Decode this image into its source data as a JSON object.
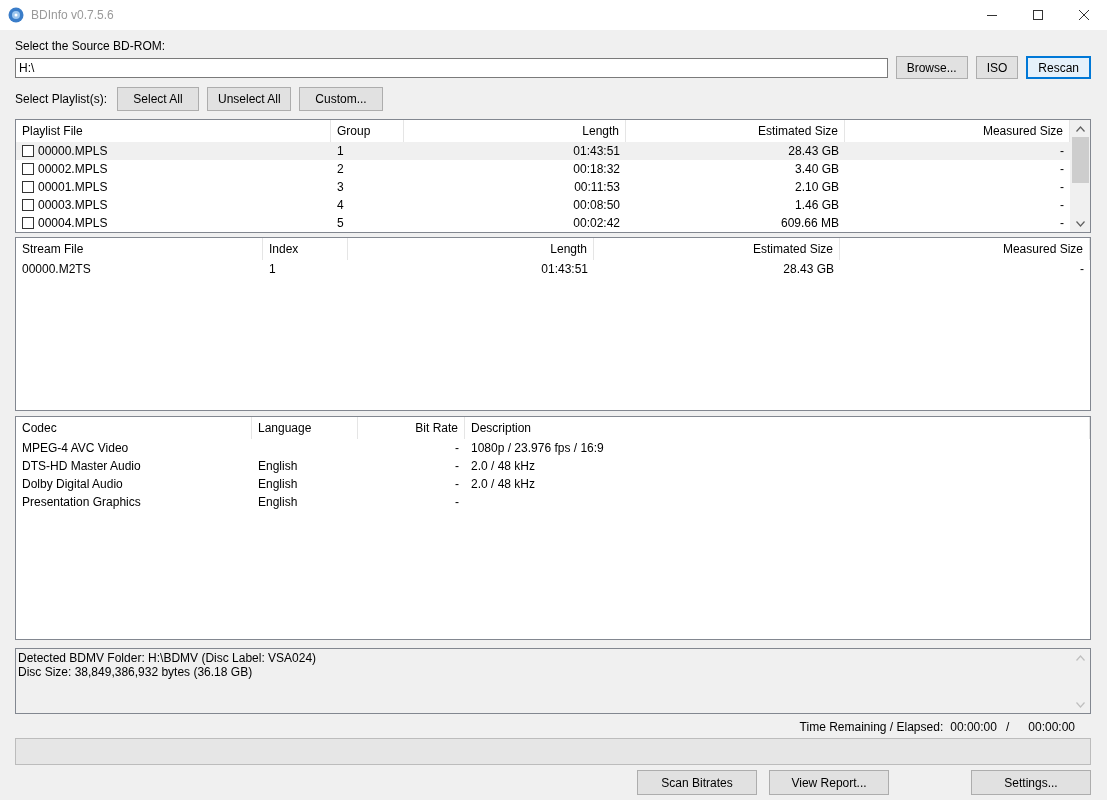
{
  "window": {
    "title": "BDInfo v0.7.5.6"
  },
  "source": {
    "label": "Select the Source BD-ROM:",
    "value": "H:\\",
    "buttons": [
      {
        "label": "Browse...",
        "selected": false
      },
      {
        "label": "ISO",
        "selected": false
      },
      {
        "label": "Rescan",
        "selected": true
      }
    ]
  },
  "playlist_select": {
    "label": "Select Playlist(s):",
    "buttons": [
      "Select All",
      "Unselect All",
      "Custom..."
    ]
  },
  "playlists": {
    "columns": [
      "Playlist File",
      "Group",
      "Length",
      "Estimated Size",
      "Measured Size"
    ],
    "rows": [
      {
        "checked": false,
        "selected": true,
        "cells": [
          "00000.MPLS",
          "1",
          "01:43:51",
          "28.43 GB",
          "-"
        ]
      },
      {
        "checked": false,
        "selected": false,
        "cells": [
          "00002.MPLS",
          "2",
          "00:18:32",
          "3.40 GB",
          "-"
        ]
      },
      {
        "checked": false,
        "selected": false,
        "cells": [
          "00001.MPLS",
          "3",
          "00:11:53",
          "2.10 GB",
          "-"
        ]
      },
      {
        "checked": false,
        "selected": false,
        "cells": [
          "00003.MPLS",
          "4",
          "00:08:50",
          "1.46 GB",
          "-"
        ]
      },
      {
        "checked": false,
        "selected": false,
        "cells": [
          "00004.MPLS",
          "5",
          "00:02:42",
          "609.66 MB",
          "-"
        ]
      }
    ]
  },
  "streams": {
    "columns": [
      "Stream File",
      "Index",
      "Length",
      "Estimated Size",
      "Measured Size"
    ],
    "rows": [
      [
        "00000.M2TS",
        "1",
        "01:43:51",
        "28.43 GB",
        "-"
      ]
    ]
  },
  "codecs": {
    "columns": [
      "Codec",
      "Language",
      "Bit Rate",
      "Description"
    ],
    "rows": [
      [
        "MPEG-4 AVC Video",
        "",
        "-",
        "1080p / 23.976 fps / 16:9"
      ],
      [
        "DTS-HD Master Audio",
        "English",
        "-",
        "2.0 / 48 kHz"
      ],
      [
        "Dolby Digital Audio",
        "English",
        "-",
        "2.0 / 48 kHz"
      ],
      [
        "Presentation Graphics",
        "English",
        "-",
        ""
      ]
    ]
  },
  "log": [
    "Detected BDMV Folder: H:\\BDMV (Disc Label: VSA024)",
    "Disc Size: 38,849,386,932 bytes (36.18 GB)"
  ],
  "time": {
    "label": "Time Remaining / Elapsed:",
    "remaining": "00:00:00",
    "separator": "/",
    "elapsed": "00:00:00"
  },
  "progress": {
    "level": 0
  },
  "bottom_buttons": [
    "Scan Bitrates",
    "View Report...",
    "Settings..."
  ]
}
